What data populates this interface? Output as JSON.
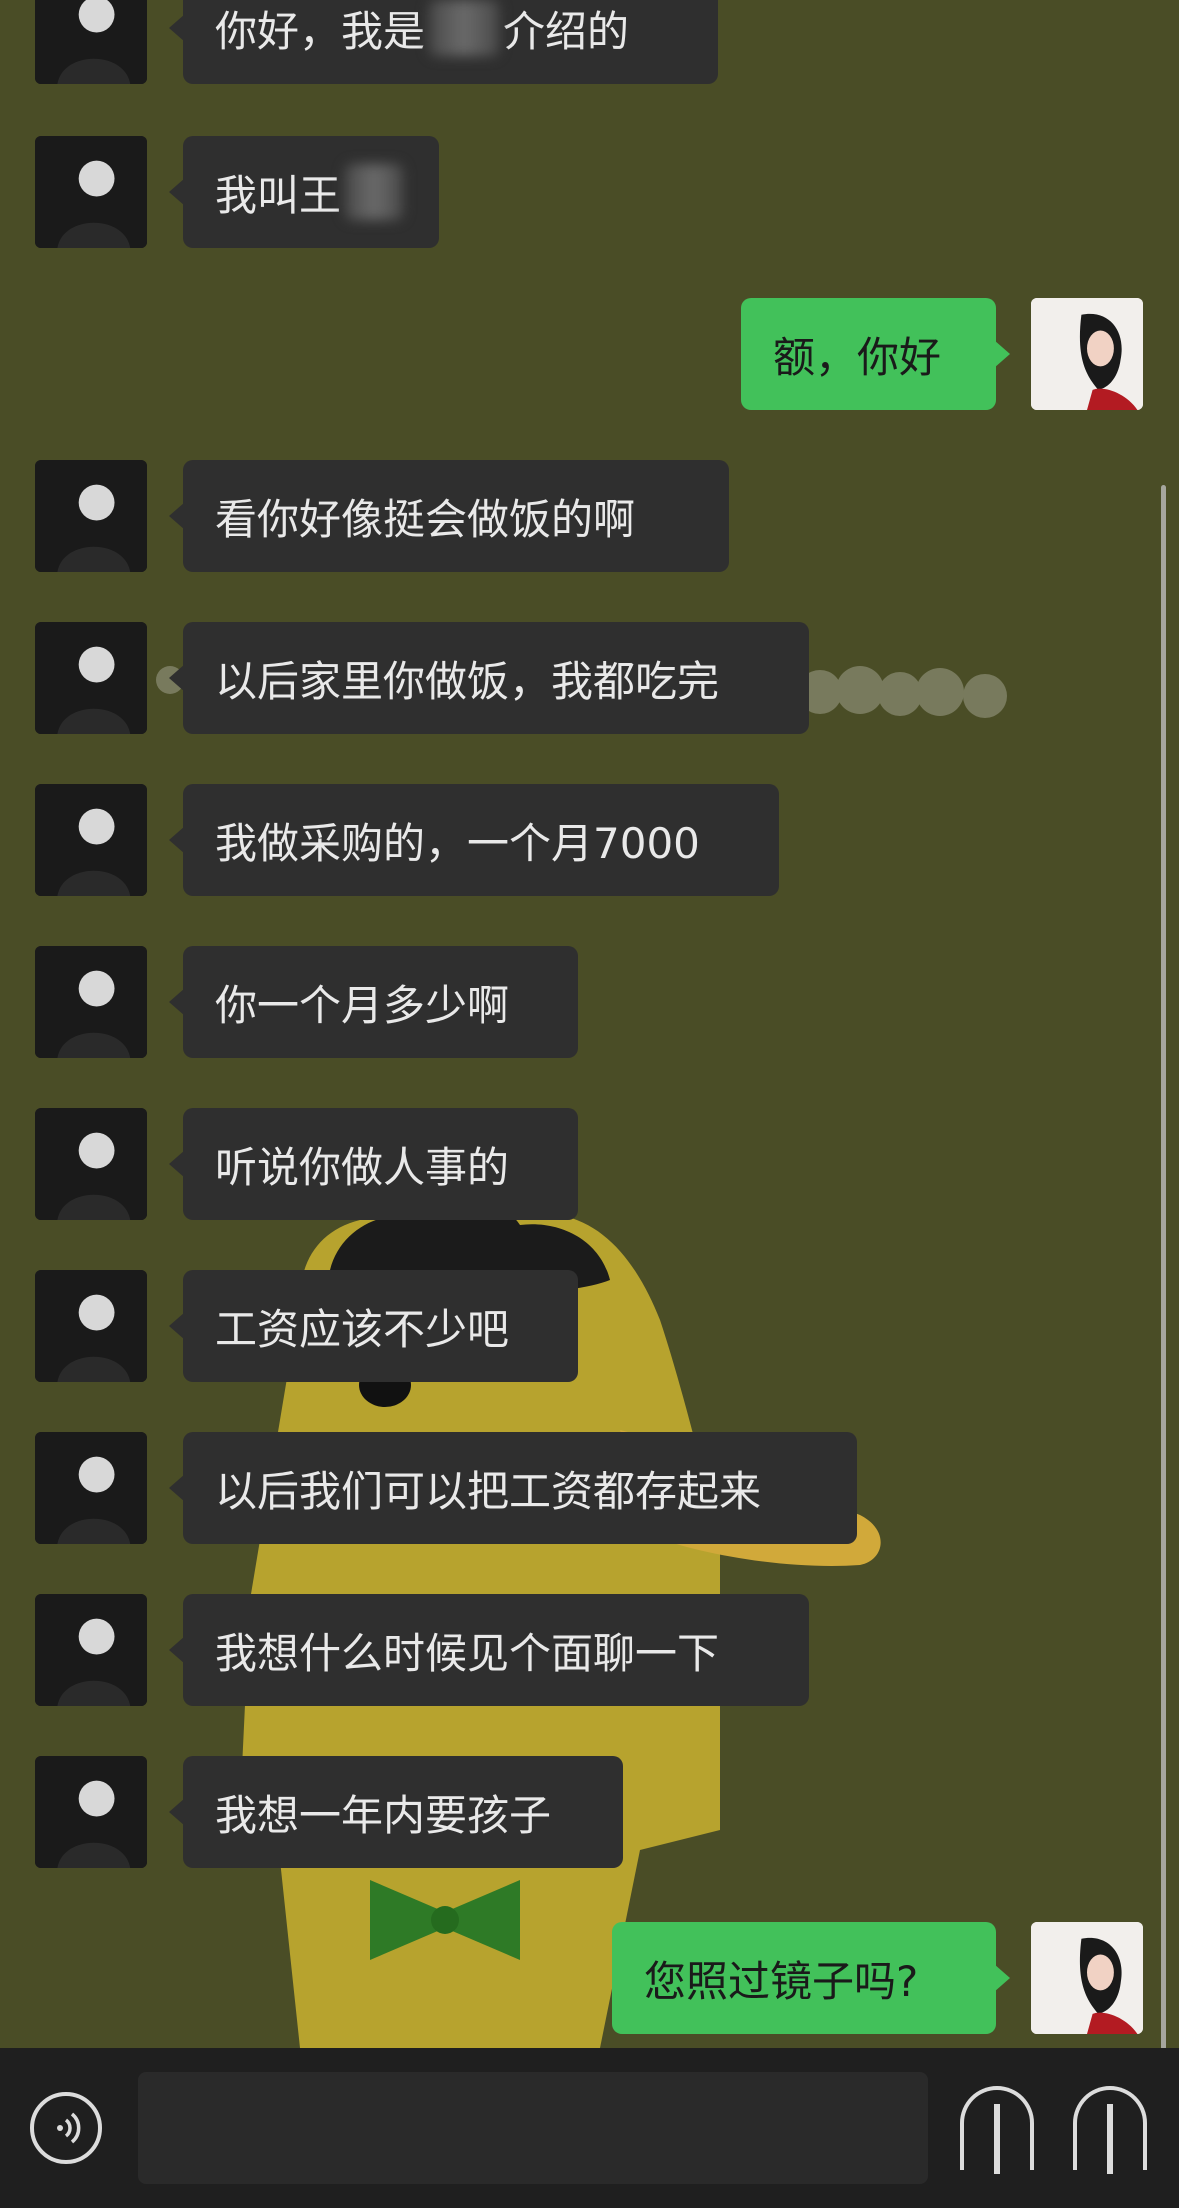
{
  "messages": [
    {
      "side": "left",
      "text_before": "你好，我是",
      "text_after": "介绍的"
    },
    {
      "side": "left",
      "text_before": "我叫王",
      "text_after": ""
    },
    {
      "side": "right",
      "text": "额，你好"
    },
    {
      "side": "left",
      "text": "看你好像挺会做饭的啊"
    },
    {
      "side": "left",
      "text": "以后家里你做饭，我都吃完"
    },
    {
      "side": "left",
      "text": "我做采购的，一个月7000"
    },
    {
      "side": "left",
      "text": "你一个月多少啊"
    },
    {
      "side": "left",
      "text": "听说你做人事的"
    },
    {
      "side": "left",
      "text": "工资应该不少吧"
    },
    {
      "side": "left",
      "text": "以后我们可以把工资都存起来"
    },
    {
      "side": "left",
      "text": "我想什么时候见个面聊一下"
    },
    {
      "side": "left",
      "text": "我想一年内要孩子"
    },
    {
      "side": "right",
      "text": "您照过镜子吗?"
    }
  ],
  "icons": {
    "left_avatar": "man-avatar-icon",
    "right_avatar": "woman-avatar-icon",
    "voice": "voice-icon",
    "emoji": "emoji-icon",
    "plus": "plus-icon"
  },
  "colors": {
    "background": "#4a4d26",
    "left_bubble": "#2f2f2f",
    "right_bubble": "#42c15a",
    "input_bar": "#1f1f1f"
  }
}
